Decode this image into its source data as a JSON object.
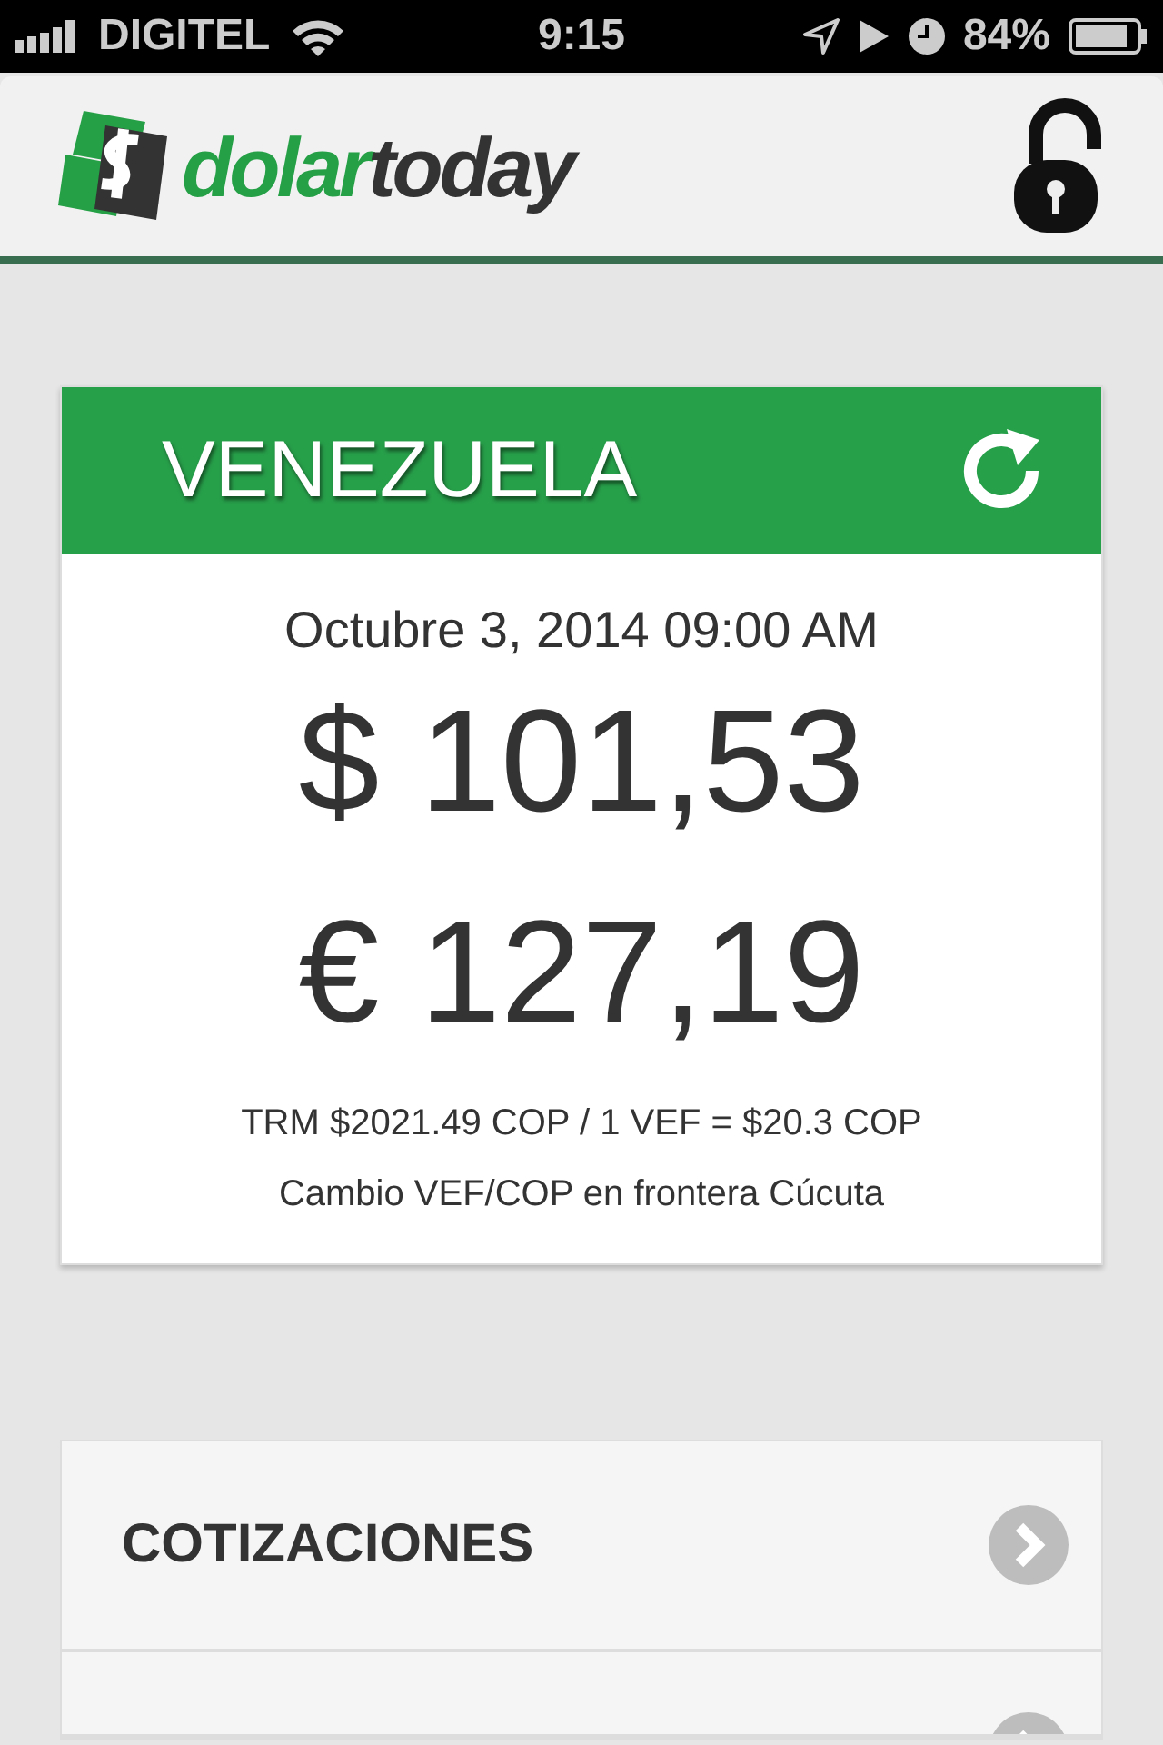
{
  "status_bar": {
    "carrier": "DIGITEL",
    "time": "9:15",
    "battery": "84%"
  },
  "header": {
    "logo_parts": [
      "dolar",
      "today"
    ]
  },
  "card": {
    "country": "VENEZUELA",
    "date": "Octubre 3, 2014 09:00 AM",
    "rates": [
      {
        "kind": "usd",
        "text": "$ 101,53"
      },
      {
        "kind": "eur",
        "text": "€ 127,19"
      }
    ],
    "notes": [
      "TRM $2021.49 COP / 1 VEF = $20.3 COP",
      "Cambio VEF/COP en frontera Cúcuta"
    ]
  },
  "menu": [
    {
      "kind": "label",
      "label": "COTIZACIONES"
    },
    {
      "kind": "blank"
    }
  ]
}
